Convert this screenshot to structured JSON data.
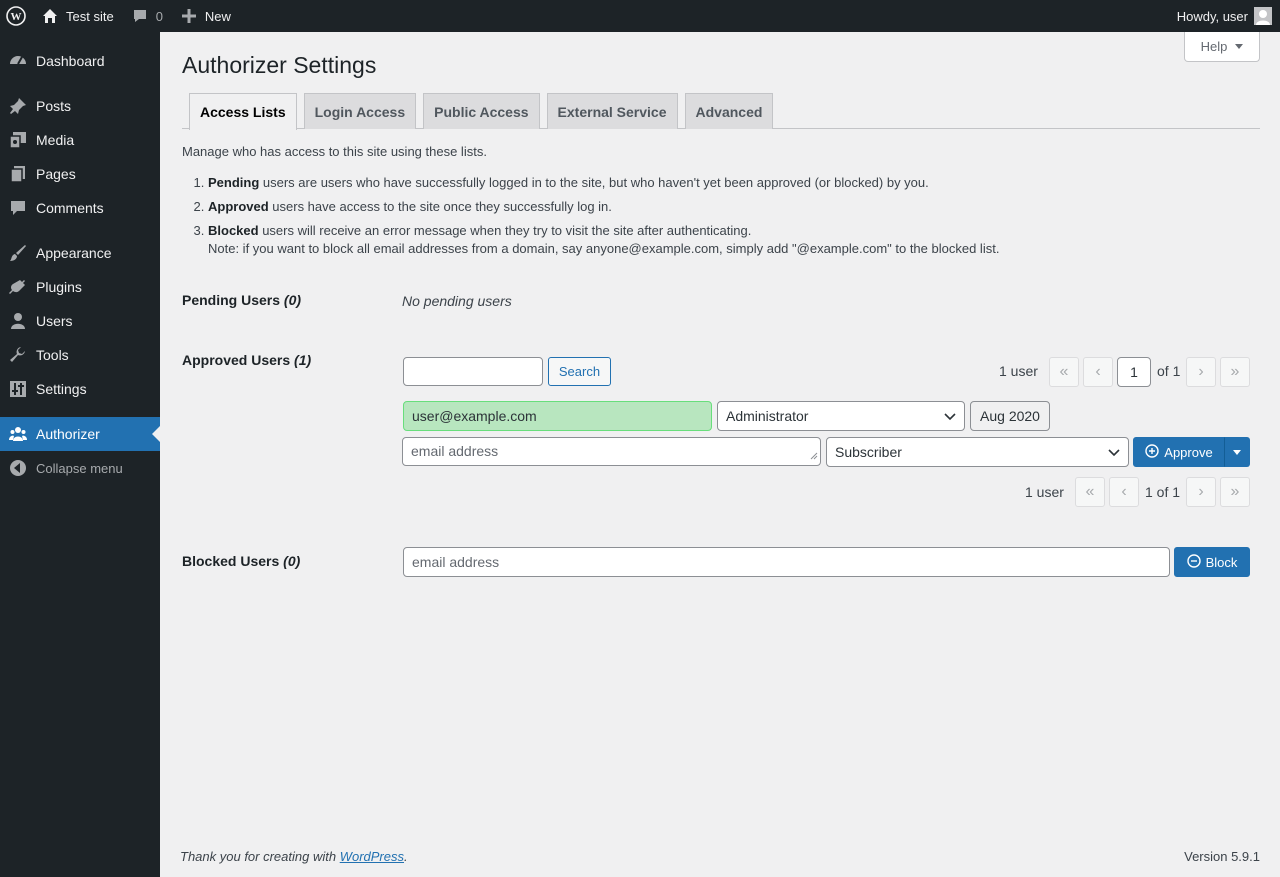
{
  "adminbar": {
    "site_name": "Test site",
    "comments_count": "0",
    "new_label": "New",
    "greeting": "Howdy, user"
  },
  "sidebar": {
    "items": [
      {
        "label": "Dashboard",
        "icon": "dashboard-icon"
      },
      {
        "label": "Posts",
        "icon": "pin-icon"
      },
      {
        "label": "Media",
        "icon": "media-icon"
      },
      {
        "label": "Pages",
        "icon": "pages-icon"
      },
      {
        "label": "Comments",
        "icon": "comment-icon"
      },
      {
        "label": "Appearance",
        "icon": "brush-icon"
      },
      {
        "label": "Plugins",
        "icon": "plug-icon"
      },
      {
        "label": "Users",
        "icon": "user-icon"
      },
      {
        "label": "Tools",
        "icon": "wrench-icon"
      },
      {
        "label": "Settings",
        "icon": "settings-icon"
      },
      {
        "label": "Authorizer",
        "icon": "groups-icon"
      }
    ],
    "collapse_label": "Collapse menu"
  },
  "header": {
    "help_label": "Help",
    "title": "Authorizer Settings"
  },
  "tabs": [
    "Access Lists",
    "Login Access",
    "Public Access",
    "External Service",
    "Advanced"
  ],
  "intro": "Manage who has access to this site using these lists.",
  "rules": [
    {
      "term": "Pending",
      "text": " users are users who have successfully logged in to the site, but who haven't yet been approved (or blocked) by you."
    },
    {
      "term": "Approved",
      "text": " users have access to the site once they successfully log in."
    },
    {
      "term": "Blocked",
      "text": " users will receive an error message when they try to visit the site after authenticating."
    }
  ],
  "note": "Note: if you want to block all email addresses from a domain, say anyone@example.com, simply add \"@example.com\" to the blocked list.",
  "pending": {
    "label": "Pending Users",
    "count": "(0)",
    "empty_text": "No pending users"
  },
  "approved": {
    "label": "Approved Users",
    "count": "(1)",
    "search_button": "Search",
    "user_count": "1 user",
    "page_input": "1",
    "of_pages": "of 1",
    "page_summary": "1 of 1",
    "pager_first": "«",
    "pager_prev": "‹",
    "pager_next": "›",
    "pager_last": "»",
    "existing_user": {
      "email": "user@example.com",
      "role": "Administrator",
      "date": "Aug 2020"
    },
    "new_user": {
      "email_placeholder": "email address",
      "role": "Subscriber",
      "approve_label": "Approve"
    }
  },
  "blocked": {
    "label": "Blocked Users",
    "count": "(0)",
    "email_placeholder": "email address",
    "block_label": "Block"
  },
  "footer": {
    "thanks_prefix": "Thank you for creating with ",
    "link_text": "WordPress",
    "thanks_suffix": ".",
    "version": "Version 5.9.1"
  },
  "colors": {
    "sidebar_bg": "#1d2327",
    "accent": "#2271b1",
    "approved_bg": "#b8e6bf",
    "approved_border": "#68de7c"
  }
}
